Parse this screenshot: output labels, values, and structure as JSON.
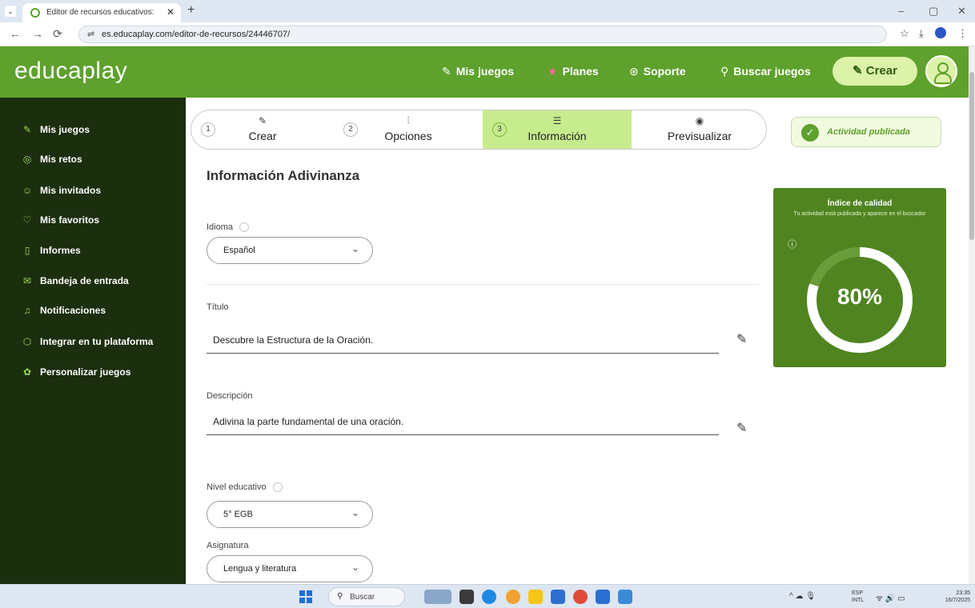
{
  "browser": {
    "tab_title": "Editor de recursos educativos: ",
    "tab_close": "✕",
    "new_tab": "+",
    "window_controls": [
      "–",
      "▢",
      "✕"
    ],
    "nav": [
      "←",
      "→",
      "⟳"
    ],
    "url": "es.educaplay.com/editor-de-recursos/24446707/",
    "url_icon": "site-settings-icon",
    "addr_icons": [
      "☆",
      "⤓",
      "⋮"
    ]
  },
  "header": {
    "logo": "educaplay",
    "nav": [
      {
        "icon": "puzzle-icon",
        "glyph": "✎",
        "label": "Mis juegos"
      },
      {
        "icon": "star-icon",
        "glyph": "★",
        "label": "Planes"
      },
      {
        "icon": "lifebuoy-icon",
        "glyph": "⊛",
        "label": "Soporte"
      },
      {
        "icon": "search-puzzle-icon",
        "glyph": "⚲",
        "label": "Buscar juegos"
      }
    ],
    "create_label": "Crear",
    "create_glyph": "✎"
  },
  "sidebar": {
    "items": [
      {
        "icon": "puzzle-icon",
        "glyph": "✎",
        "label": "Mis juegos"
      },
      {
        "icon": "target-icon",
        "glyph": "◎",
        "label": "Mis retos"
      },
      {
        "icon": "users-icon",
        "glyph": "☺",
        "label": "Mis invitados"
      },
      {
        "icon": "heart-icon",
        "glyph": "♡",
        "label": "Mis favoritos"
      },
      {
        "icon": "report-icon",
        "glyph": "▯",
        "label": "Informes"
      },
      {
        "icon": "mail-icon",
        "glyph": "✉",
        "label": "Bandeja de entrada"
      },
      {
        "icon": "bell-icon",
        "glyph": "♫",
        "label": "Notificaciones"
      },
      {
        "icon": "cube-icon",
        "glyph": "⬡",
        "label": "Integrar en tu plataforma"
      },
      {
        "icon": "customize-icon",
        "glyph": "✿",
        "label": "Personalizar juegos"
      }
    ]
  },
  "stepper": {
    "steps": [
      {
        "num": "1",
        "icon": "puzzle-icon",
        "glyph": "✎",
        "label": "Crear"
      },
      {
        "num": "2",
        "icon": "sliders-icon",
        "glyph": "⫶",
        "label": "Opciones"
      },
      {
        "num": "3",
        "icon": "list-icon",
        "glyph": "☰",
        "label": "Información"
      },
      {
        "num": "",
        "icon": "eye-icon",
        "glyph": "◉",
        "label": "Previsualizar"
      }
    ],
    "active_step": 3
  },
  "status": {
    "published_label": "Actividad publicada",
    "check": "✓"
  },
  "form": {
    "title": "Información Adivinanza",
    "language_label": "Idioma",
    "language_value": "Español",
    "title_label": "Título",
    "title_value": "Descubre la Estructura de la Oración.",
    "description_label": "Descripción",
    "description_value": "Adivina la parte fundamental de una oración.",
    "level_label": "Nivel educativo",
    "level_value": "5° EGB",
    "subject_label": "Asignatura",
    "subject_value": "Lengua y literatura",
    "chevron": "⌄",
    "pencil": "✎"
  },
  "quality": {
    "title": "Índice de calidad",
    "subtitle": "Tu actividad está publicada y aparece en el buscador",
    "info": "ⓘ",
    "percent_text": "80%",
    "percent": 80
  },
  "taskbar": {
    "search_label": "Buscar",
    "search_icon": "⚲",
    "tray_icons": "^  ☁  🎙",
    "lang_top": "ESP",
    "lang_bottom": "INTL",
    "net_audio": "ᯤ 🔊 ▭",
    "time": "23:35",
    "date": "16/7/2025"
  },
  "colors": {
    "brand_green": "#5ea12c",
    "sidebar_bg": "#1b2e0e",
    "active_step": "#c7ec8d",
    "quality_bg": "#4f8420"
  }
}
